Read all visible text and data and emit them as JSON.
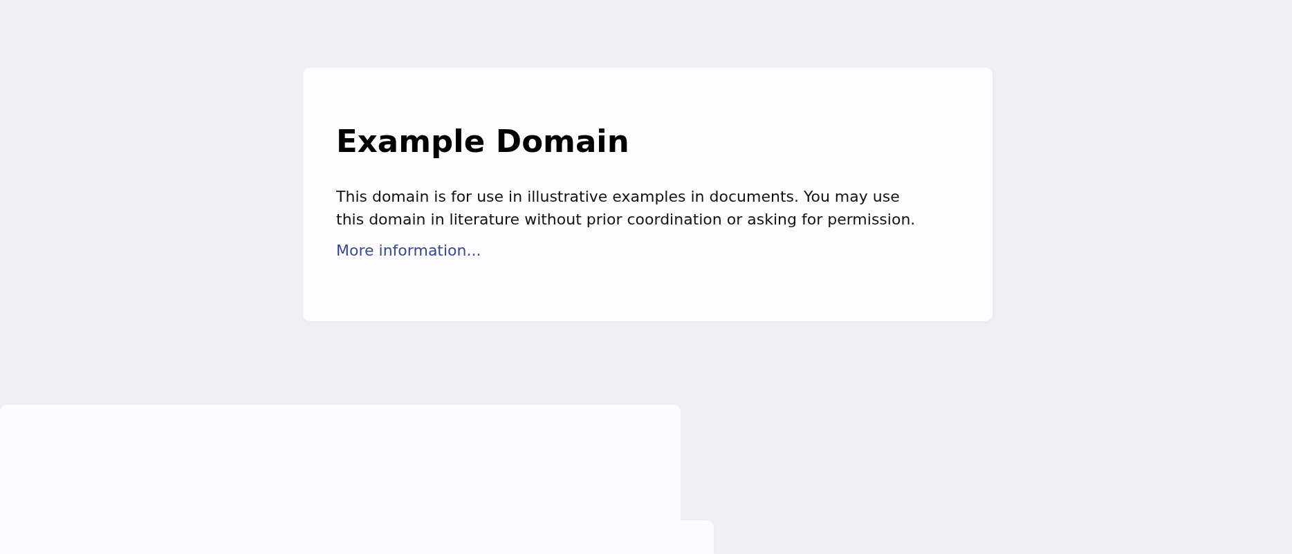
{
  "card": {
    "title": "Example Domain",
    "text": "This domain is for use in illustrative examples in documents. You may use this domain in literature without prior coordination or asking for permission.",
    "link": "More information..."
  }
}
